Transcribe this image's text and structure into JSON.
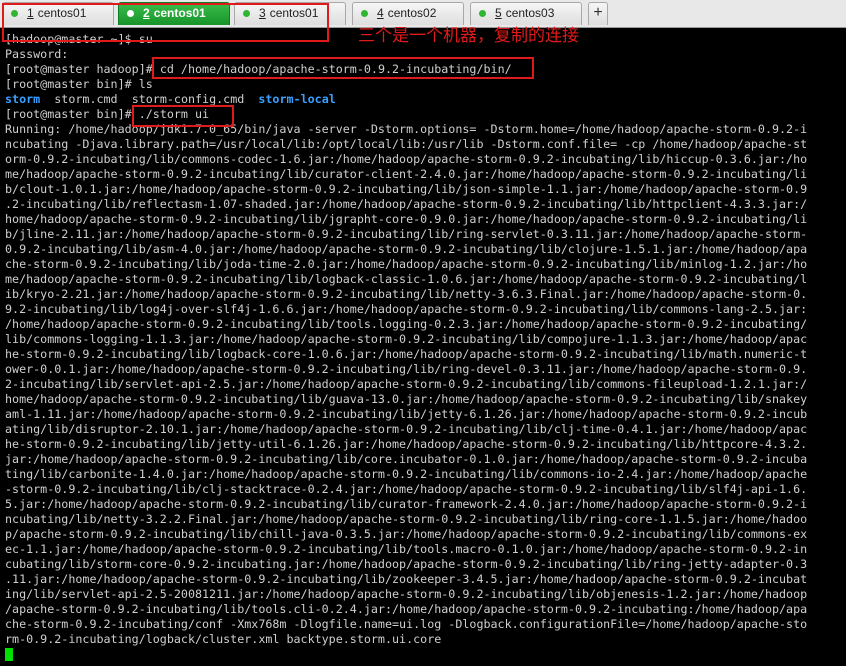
{
  "tabs": [
    {
      "num": "1",
      "label": "centos01",
      "active": false
    },
    {
      "num": "2",
      "label": "centos01",
      "active": true
    },
    {
      "num": "3",
      "label": "centos01",
      "active": false
    },
    {
      "num": "4",
      "label": "centos02",
      "active": false
    },
    {
      "num": "5",
      "label": "centos03",
      "active": false
    }
  ],
  "new_tab_label": "+",
  "annotation": "三个是一个机器，复制的连接",
  "terminal": {
    "line1": "[hadoop@master ~]$ su",
    "line2": "Password:",
    "prompt3": "[root@master hadoop]# ",
    "cmd3": "cd /home/hadoop/apache-storm-0.9.2-incubating/bin/",
    "line4": "[root@master bin]# ls",
    "ls_items": [
      "storm",
      "storm.cmd",
      "storm-config.cmd",
      "storm-local"
    ],
    "prompt6": "[root@master bin]# ",
    "cmd6": "./storm ui",
    "output": [
      "Running: /home/hadoop/jdk1.7.0_65/bin/java -server -Dstorm.options= -Dstorm.home=/home/hadoop/apache-storm-0.9.2-i",
      "ncubating -Djava.library.path=/usr/local/lib:/opt/local/lib:/usr/lib -Dstorm.conf.file= -cp /home/hadoop/apache-st",
      "orm-0.9.2-incubating/lib/commons-codec-1.6.jar:/home/hadoop/apache-storm-0.9.2-incubating/lib/hiccup-0.3.6.jar:/ho",
      "me/hadoop/apache-storm-0.9.2-incubating/lib/curator-client-2.4.0.jar:/home/hadoop/apache-storm-0.9.2-incubating/li",
      "b/clout-1.0.1.jar:/home/hadoop/apache-storm-0.9.2-incubating/lib/json-simple-1.1.jar:/home/hadoop/apache-storm-0.9",
      ".2-incubating/lib/reflectasm-1.07-shaded.jar:/home/hadoop/apache-storm-0.9.2-incubating/lib/httpclient-4.3.3.jar:/",
      "home/hadoop/apache-storm-0.9.2-incubating/lib/jgrapht-core-0.9.0.jar:/home/hadoop/apache-storm-0.9.2-incubating/li",
      "b/jline-2.11.jar:/home/hadoop/apache-storm-0.9.2-incubating/lib/ring-servlet-0.3.11.jar:/home/hadoop/apache-storm-",
      "0.9.2-incubating/lib/asm-4.0.jar:/home/hadoop/apache-storm-0.9.2-incubating/lib/clojure-1.5.1.jar:/home/hadoop/apa",
      "che-storm-0.9.2-incubating/lib/joda-time-2.0.jar:/home/hadoop/apache-storm-0.9.2-incubating/lib/minlog-1.2.jar:/ho",
      "me/hadoop/apache-storm-0.9.2-incubating/lib/logback-classic-1.0.6.jar:/home/hadoop/apache-storm-0.9.2-incubating/l",
      "ib/kryo-2.21.jar:/home/hadoop/apache-storm-0.9.2-incubating/lib/netty-3.6.3.Final.jar:/home/hadoop/apache-storm-0.",
      "9.2-incubating/lib/log4j-over-slf4j-1.6.6.jar:/home/hadoop/apache-storm-0.9.2-incubating/lib/commons-lang-2.5.jar:",
      "/home/hadoop/apache-storm-0.9.2-incubating/lib/tools.logging-0.2.3.jar:/home/hadoop/apache-storm-0.9.2-incubating/",
      "lib/commons-logging-1.1.3.jar:/home/hadoop/apache-storm-0.9.2-incubating/lib/compojure-1.1.3.jar:/home/hadoop/apac",
      "he-storm-0.9.2-incubating/lib/logback-core-1.0.6.jar:/home/hadoop/apache-storm-0.9.2-incubating/lib/math.numeric-t",
      "ower-0.0.1.jar:/home/hadoop/apache-storm-0.9.2-incubating/lib/ring-devel-0.3.11.jar:/home/hadoop/apache-storm-0.9.",
      "2-incubating/lib/servlet-api-2.5.jar:/home/hadoop/apache-storm-0.9.2-incubating/lib/commons-fileupload-1.2.1.jar:/",
      "home/hadoop/apache-storm-0.9.2-incubating/lib/guava-13.0.jar:/home/hadoop/apache-storm-0.9.2-incubating/lib/snakey",
      "aml-1.11.jar:/home/hadoop/apache-storm-0.9.2-incubating/lib/jetty-6.1.26.jar:/home/hadoop/apache-storm-0.9.2-incub",
      "ating/lib/disruptor-2.10.1.jar:/home/hadoop/apache-storm-0.9.2-incubating/lib/clj-time-0.4.1.jar:/home/hadoop/apac",
      "he-storm-0.9.2-incubating/lib/jetty-util-6.1.26.jar:/home/hadoop/apache-storm-0.9.2-incubating/lib/httpcore-4.3.2.",
      "jar:/home/hadoop/apache-storm-0.9.2-incubating/lib/core.incubator-0.1.0.jar:/home/hadoop/apache-storm-0.9.2-incuba",
      "ting/lib/carbonite-1.4.0.jar:/home/hadoop/apache-storm-0.9.2-incubating/lib/commons-io-2.4.jar:/home/hadoop/apache",
      "-storm-0.9.2-incubating/lib/clj-stacktrace-0.2.4.jar:/home/hadoop/apache-storm-0.9.2-incubating/lib/slf4j-api-1.6.",
      "5.jar:/home/hadoop/apache-storm-0.9.2-incubating/lib/curator-framework-2.4.0.jar:/home/hadoop/apache-storm-0.9.2-i",
      "ncubating/lib/netty-3.2.2.Final.jar:/home/hadoop/apache-storm-0.9.2-incubating/lib/ring-core-1.1.5.jar:/home/hadoo",
      "p/apache-storm-0.9.2-incubating/lib/chill-java-0.3.5.jar:/home/hadoop/apache-storm-0.9.2-incubating/lib/commons-ex",
      "ec-1.1.jar:/home/hadoop/apache-storm-0.9.2-incubating/lib/tools.macro-0.1.0.jar:/home/hadoop/apache-storm-0.9.2-in",
      "cubating/lib/storm-core-0.9.2-incubating.jar:/home/hadoop/apache-storm-0.9.2-incubating/lib/ring-jetty-adapter-0.3",
      ".11.jar:/home/hadoop/apache-storm-0.9.2-incubating/lib/zookeeper-3.4.5.jar:/home/hadoop/apache-storm-0.9.2-incubat",
      "ing/lib/servlet-api-2.5-20081211.jar:/home/hadoop/apache-storm-0.9.2-incubating/lib/objenesis-1.2.jar:/home/hadoop",
      "/apache-storm-0.9.2-incubating/lib/tools.cli-0.2.4.jar:/home/hadoop/apache-storm-0.9.2-incubating:/home/hadoop/apa",
      "che-storm-0.9.2-incubating/conf -Xmx768m -Dlogfile.name=ui.log -Dlogback.configurationFile=/home/hadoop/apache-sto",
      "rm-0.9.2-incubating/logback/cluster.xml backtype.storm.ui.core"
    ]
  }
}
